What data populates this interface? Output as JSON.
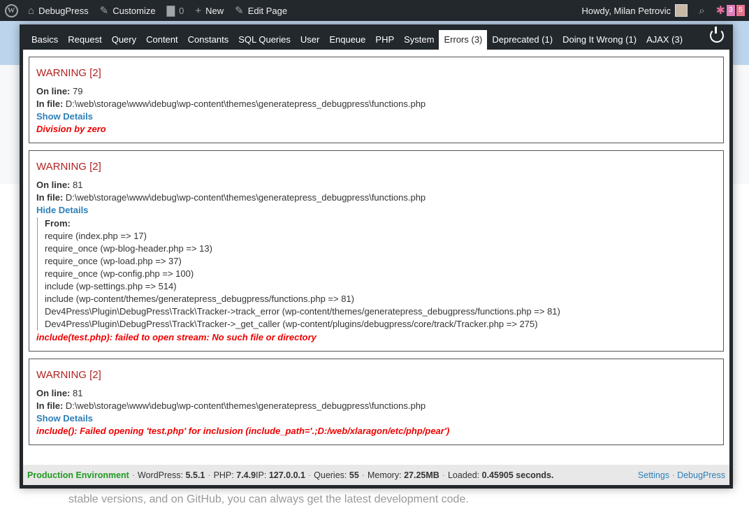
{
  "adminbar": {
    "site_name": "DebugPress",
    "customize": "Customize",
    "comments_count": "0",
    "new_label": "New",
    "edit_page": "Edit Page",
    "howdy": "Howdy, Milan Petrovic",
    "badge_a": "3",
    "badge_b": "5"
  },
  "tabs": [
    "Basics",
    "Request",
    "Query",
    "Content",
    "Constants",
    "SQL Queries",
    "User",
    "Enqueue",
    "PHP",
    "System",
    "Errors (3)",
    "Deprecated (1)",
    "Doing It Wrong (1)",
    "AJAX (3)"
  ],
  "labels": {
    "on_line": "On line:",
    "in_file": "In file:",
    "from": "From:"
  },
  "errors": [
    {
      "title": "WARNING [2]",
      "line": "79",
      "file": "D:\\web\\storage\\www\\debug\\wp-content\\themes\\generatepress_debugpress\\functions.php",
      "toggle": "Show Details",
      "message": "Division by zero"
    },
    {
      "title": "WARNING [2]",
      "line": "81",
      "file": "D:\\web\\storage\\www\\debug\\wp-content\\themes\\generatepress_debugpress\\functions.php",
      "toggle": "Hide Details",
      "trace": [
        "require (index.php => 17)",
        "require_once (wp-blog-header.php => 13)",
        "require_once (wp-load.php => 37)",
        "require_once (wp-config.php => 100)",
        "include (wp-settings.php => 514)",
        "include (wp-content/themes/generatepress_debugpress/functions.php => 81)",
        "Dev4Press\\Plugin\\DebugPress\\Track\\Tracker->track_error (wp-content/themes/generatepress_debugpress/functions.php => 81)",
        "Dev4Press\\Plugin\\DebugPress\\Track\\Tracker->_get_caller (wp-content/plugins/debugpress/core/track/Tracker.php => 275)"
      ],
      "message": "include(test.php): failed to open stream: No such file or directory"
    },
    {
      "title": "WARNING [2]",
      "line": "81",
      "file": "D:\\web\\storage\\www\\debug\\wp-content\\themes\\generatepress_debugpress\\functions.php",
      "toggle": "Show Details",
      "message": "include(): Failed opening 'test.php' for inclusion (include_path='.;D:/web/xlaragon/etc/php/pear')"
    }
  ],
  "footer": {
    "environment": "Production Environment",
    "wordpress_label": "WordPress:",
    "wordpress": "5.5.1",
    "php_label": "PHP:",
    "php": "7.4.9",
    "ip_label": "IP:",
    "ip": "127.0.0.1",
    "queries_label": "Queries:",
    "queries": "55",
    "memory_label": "Memory:",
    "memory": "27.25MB",
    "loaded_label": "Loaded:",
    "loaded": "0.45905 seconds.",
    "settings": "Settings",
    "debugpress": "DebugPress"
  },
  "page": {
    "behind_text": "stable versions, and on GitHub, you can always get the latest development code."
  },
  "colors": {
    "adminbar_bg": "#23282d",
    "warning_title": "#b22222",
    "error_message": "#ee0000",
    "link": "#2e7fb8",
    "environment": "#209a20"
  }
}
